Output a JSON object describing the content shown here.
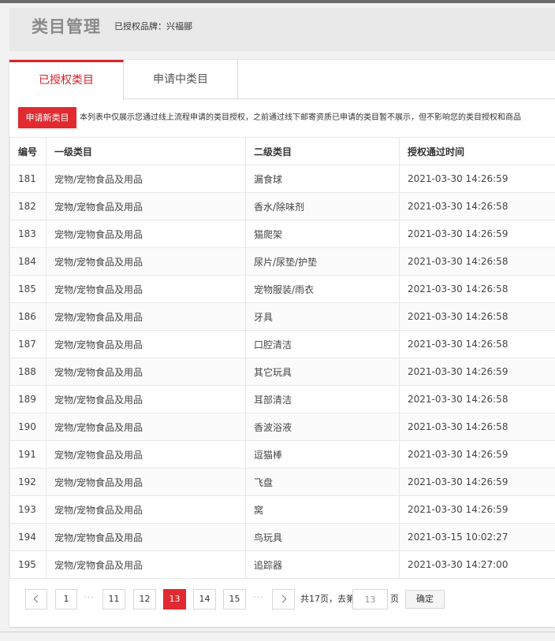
{
  "header": {
    "title": "类目管理",
    "brand_label": "已授权品牌：",
    "brand_value": "兴福郦"
  },
  "tabs": [
    {
      "label": "已授权类目",
      "active": true
    },
    {
      "label": "申请中类目",
      "active": false
    }
  ],
  "toolbar": {
    "apply_button": "申请新类目",
    "notice": "本列表中仅展示您通过线上流程申请的类目授权，之前通过线下邮寄资质已申请的类目暂不展示，但不影响您的类目授权和商品"
  },
  "table": {
    "headers": [
      "编号",
      "一级类目",
      "二级类目",
      "授权通过时间"
    ],
    "rows": [
      [
        "181",
        "宠物/宠物食品及用品",
        "漏食球",
        "2021-03-30 14:26:59"
      ],
      [
        "182",
        "宠物/宠物食品及用品",
        "香水/除味剂",
        "2021-03-30 14:26:58"
      ],
      [
        "183",
        "宠物/宠物食品及用品",
        "猫爬架",
        "2021-03-30 14:26:59"
      ],
      [
        "184",
        "宠物/宠物食品及用品",
        "尿片/尿垫/护垫",
        "2021-03-30 14:26:58"
      ],
      [
        "185",
        "宠物/宠物食品及用品",
        "宠物服装/雨衣",
        "2021-03-30 14:26:58"
      ],
      [
        "186",
        "宠物/宠物食品及用品",
        "牙具",
        "2021-03-30 14:26:58"
      ],
      [
        "187",
        "宠物/宠物食品及用品",
        "口腔清洁",
        "2021-03-30 14:26:58"
      ],
      [
        "188",
        "宠物/宠物食品及用品",
        "其它玩具",
        "2021-03-30 14:26:59"
      ],
      [
        "189",
        "宠物/宠物食品及用品",
        "耳部清洁",
        "2021-03-30 14:26:58"
      ],
      [
        "190",
        "宠物/宠物食品及用品",
        "香波浴液",
        "2021-03-30 14:26:58"
      ],
      [
        "191",
        "宠物/宠物食品及用品",
        "逗猫棒",
        "2021-03-30 14:26:59"
      ],
      [
        "192",
        "宠物/宠物食品及用品",
        "飞盘",
        "2021-03-30 14:26:59"
      ],
      [
        "193",
        "宠物/宠物食品及用品",
        "窝",
        "2021-03-30 14:26:59"
      ],
      [
        "194",
        "宠物/宠物食品及用品",
        "鸟玩具",
        "2021-03-15 10:02:27"
      ],
      [
        "195",
        "宠物/宠物食品及用品",
        "追踪器",
        "2021-03-30 14:27:00"
      ]
    ]
  },
  "pagination": {
    "first": "1",
    "dots": "···",
    "pages": [
      "11",
      "12",
      "13",
      "14",
      "15"
    ],
    "current": "13",
    "total_text": "共17页，去第",
    "jump_value": "13",
    "page_suffix": "页",
    "confirm_label": "确定"
  },
  "colors": {
    "accent": "#e02a2f",
    "title_gray": "#8a8a8a"
  }
}
